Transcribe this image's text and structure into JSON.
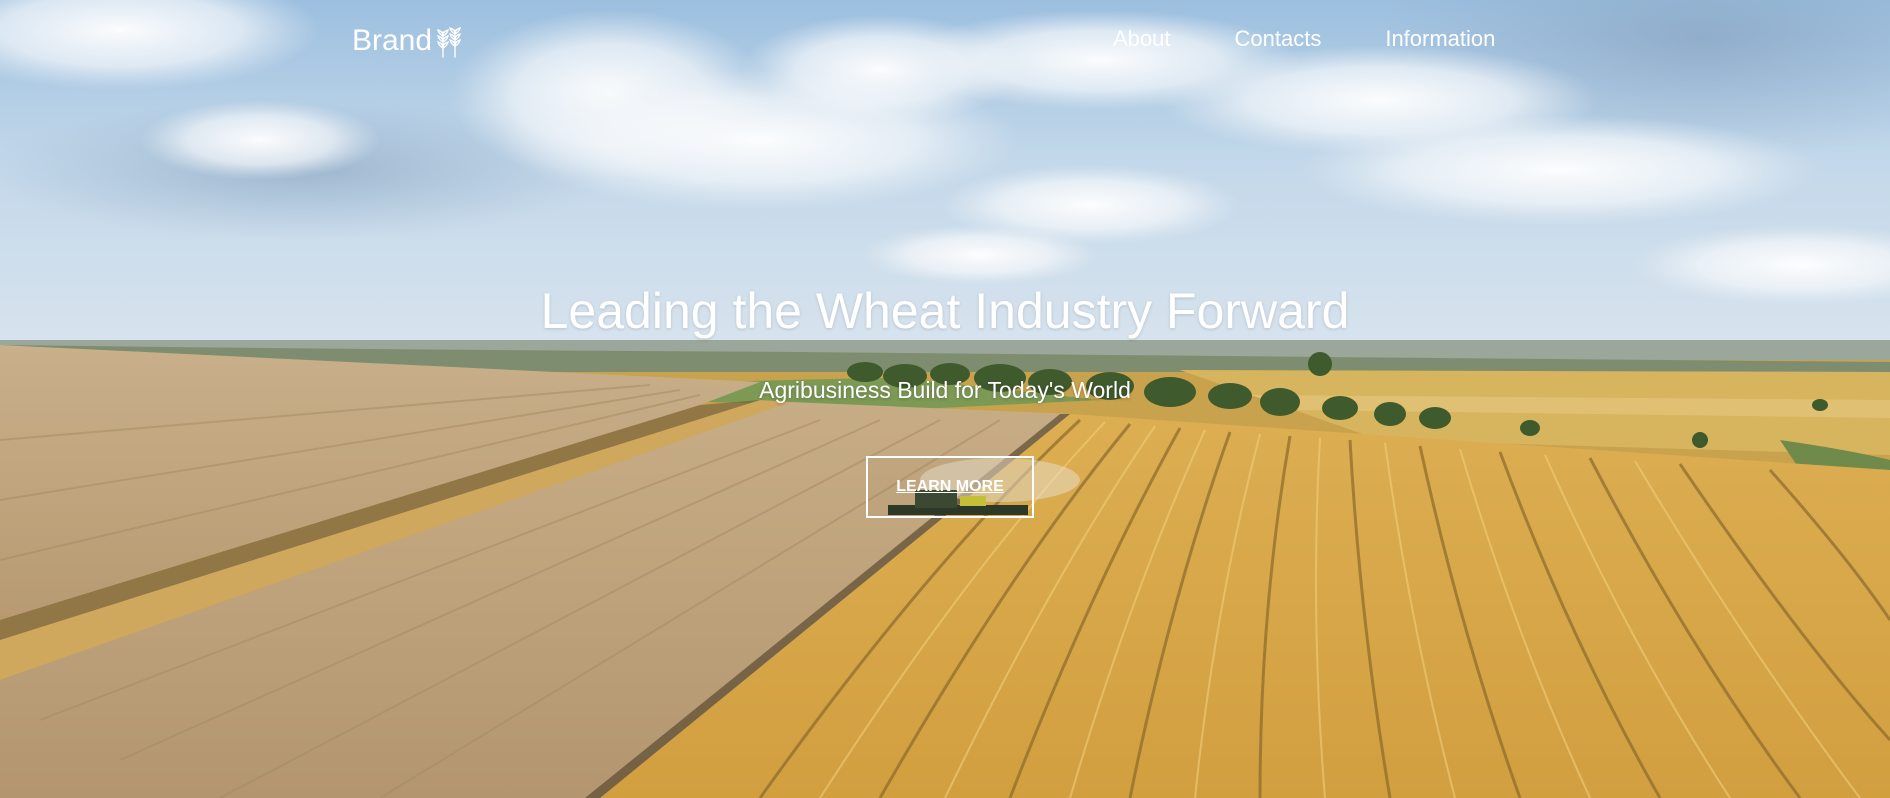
{
  "nav": {
    "brand": "Brand",
    "brand_icon": "wheat-icon",
    "links": [
      {
        "label": "About"
      },
      {
        "label": "Contacts"
      },
      {
        "label": "Information"
      }
    ]
  },
  "hero": {
    "title": "Leading the Wheat Industry Forward",
    "subtitle": "Agribusiness Build for Today's World",
    "cta_label": "LEARN MORE",
    "background": "aerial-wheat-field-photo"
  },
  "colors": {
    "text": "#ffffff",
    "sky": "#b9d3ea",
    "wheat": "#d2a64c",
    "field_dry": "#bfa072"
  }
}
